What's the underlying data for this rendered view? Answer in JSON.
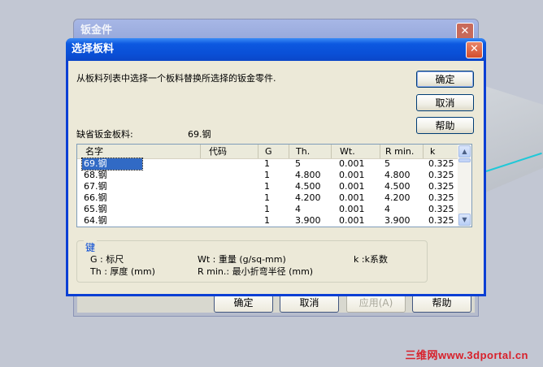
{
  "parent_dialog": {
    "title": "钣金件",
    "buttons": [
      "确定",
      "取消",
      "应用(A)",
      "帮助"
    ]
  },
  "dialog": {
    "title": "选择板料",
    "instruction": "从板料列表中选择一个板料替换所选择的钣金零件.",
    "buttons": {
      "ok": "确定",
      "cancel": "取消",
      "help": "帮助"
    },
    "default_material_label": "缺省钣金板料:",
    "default_material_value": "69.钢",
    "columns": [
      "名字",
      "代码",
      "G",
      "Th.",
      "Wt.",
      "R min.",
      "k"
    ],
    "rows": [
      [
        "69.钢",
        "",
        "1",
        "5",
        "0.001",
        "5",
        "0.325"
      ],
      [
        "68.钢",
        "",
        "1",
        "4.800",
        "0.001",
        "4.800",
        "0.325"
      ],
      [
        "67.钢",
        "",
        "1",
        "4.500",
        "0.001",
        "4.500",
        "0.325"
      ],
      [
        "66.钢",
        "",
        "1",
        "4.200",
        "0.001",
        "4.200",
        "0.325"
      ],
      [
        "65.钢",
        "",
        "1",
        "4",
        "0.001",
        "4",
        "0.325"
      ],
      [
        "64.钢",
        "",
        "1",
        "3.900",
        "0.001",
        "3.900",
        "0.325"
      ]
    ],
    "selected_row": "69.钢",
    "key": {
      "title": "键",
      "g": "G : 标尺",
      "th": "Th : 厚度 (mm)",
      "wt": "Wt : 重量 (g/sq-mm)",
      "rmin": "R min.: 最小折弯半径 (mm)",
      "k": "k :k系数"
    }
  },
  "watermark": "三维网www.3dportal.cn",
  "icons": {
    "close": "close-icon",
    "scroll_up": "arrow-up-icon",
    "scroll_down": "arrow-down-icon"
  },
  "colors": {
    "title_bar": "#0a4fd6",
    "selection": "#316ac5",
    "key_title": "#0046d5"
  }
}
